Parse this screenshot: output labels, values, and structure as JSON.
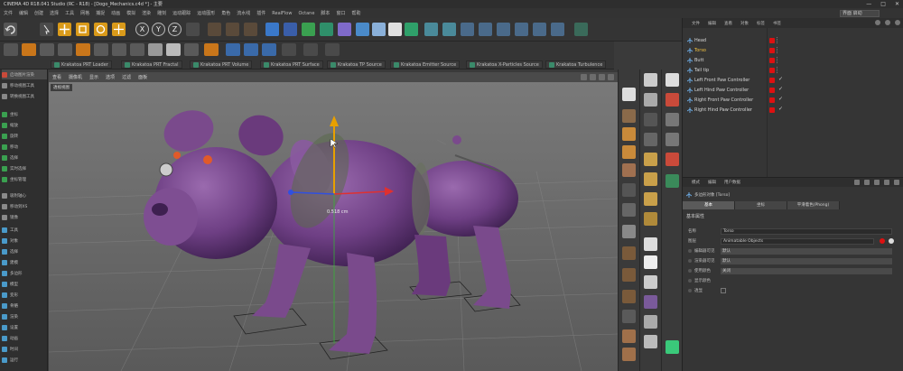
{
  "window": {
    "title": "CINEMA 4D R18.041 Studio (RC - R18) - [Dogo_Mechanics.c4d *] - 主要",
    "buttons": [
      "—",
      "□",
      "✕"
    ]
  },
  "menubar": {
    "items": [
      "文件",
      "编辑",
      "创建",
      "选择",
      "工具",
      "网格",
      "捕捉",
      "动画",
      "模拟",
      "渲染",
      "雕刻",
      "运动跟踪",
      "运动图形",
      "角色",
      "流水线",
      "插件",
      "RealFlow",
      "Octane",
      "脚本",
      "窗口",
      "帮助"
    ],
    "layout_value": "界面  启动"
  },
  "toolbar": {
    "axis_labels": [
      "X",
      "Y",
      "Z"
    ]
  },
  "pluginbar": {
    "tabs": [
      "Krakatoa PRT Loader",
      "Krakatoa PRT Fractal",
      "Krakatoa PRT Volume",
      "Krakatoa PRT Surface",
      "Krakatoa TP Source",
      "Krakatoa Emitter Source",
      "Krakatoa X-Particles Source",
      "Krakatoa Turbulence"
    ]
  },
  "leftpanel": {
    "items": [
      "启动图片渲染",
      "移动视图工具",
      "转换视图工具",
      "坐标",
      "缩放",
      "旋转",
      "移动",
      "选择",
      "实时选择",
      "坐标管理",
      "吸附轴心",
      "移动到XS",
      "镜像",
      "工具",
      "对象",
      "选择",
      "建模",
      "多边形",
      "模型",
      "变形",
      "骨骼",
      "渲染",
      "设置",
      "动画",
      "时间",
      "运行"
    ]
  },
  "viewport": {
    "menu": [
      "查看",
      "摄像机",
      "显示",
      "选项",
      "过滤",
      "面板"
    ],
    "label": "透视视图",
    "hud_value": "0.518 cm"
  },
  "objects": {
    "tabs": [
      "文件",
      "编辑",
      "查看",
      "对象",
      "标签",
      "书签"
    ],
    "items": [
      {
        "name": "Head",
        "checked": false
      },
      {
        "name": "Torso",
        "checked": false
      },
      {
        "name": "Butt",
        "checked": false
      },
      {
        "name": "Tail tip",
        "checked": false
      },
      {
        "name": "Left Front Paw Controller",
        "checked": true
      },
      {
        "name": "Left Hind Paw Controller",
        "checked": true
      },
      {
        "name": "Right Front Paw Controller",
        "checked": true
      },
      {
        "name": "Right Hind Paw Controller",
        "checked": true
      }
    ]
  },
  "attributes": {
    "tabs": [
      "模式",
      "编辑",
      "用户数据"
    ],
    "object_header": "多边形对象 [Torso]",
    "subtabs": [
      "基本",
      "坐标",
      "平滑着色(Phong)"
    ],
    "section": "基本属性",
    "fields": [
      {
        "label": "名称",
        "value": "Torso"
      },
      {
        "label": "图层",
        "value": "Animatable Objects"
      },
      {
        "label": "编辑器可见",
        "value": "默认"
      },
      {
        "label": "渲染器可见",
        "value": "默认"
      },
      {
        "label": "使用颜色",
        "value": "关闭"
      },
      {
        "label": "显示颜色",
        "value": ""
      },
      {
        "label": "透显",
        "value": ""
      }
    ]
  },
  "colors": {
    "accent_red": "#dd1111",
    "dog_purple": "#7a4a8c",
    "viewport_bg": "#6a6a6a"
  }
}
